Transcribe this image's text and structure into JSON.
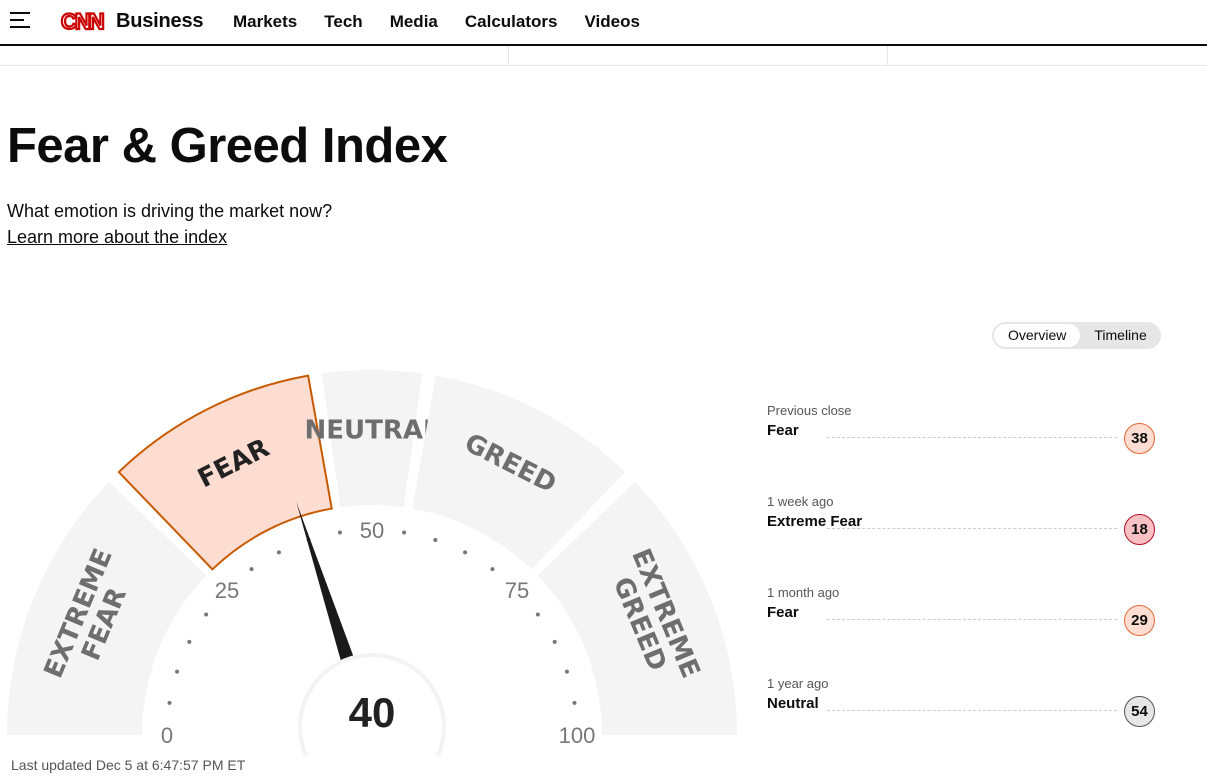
{
  "header": {
    "brand_logo": "CNN",
    "brand_section": "Business",
    "nav": [
      "Markets",
      "Tech",
      "Media",
      "Calculators",
      "Videos"
    ]
  },
  "page": {
    "title": "Fear & Greed Index",
    "subtitle": "What emotion is driving the market now?",
    "learn_link": "Learn more about the index",
    "last_updated": "Last updated Dec 5 at 6:47:57 PM ET"
  },
  "toggle": {
    "options": [
      "Overview",
      "Timeline"
    ],
    "selected": "Overview"
  },
  "gauge": {
    "value": 40,
    "value_label": "40",
    "active_segment": "FEAR",
    "segments": [
      {
        "label": "EXTREME FEAR",
        "lines": [
          "EXTREME",
          "FEAR"
        ],
        "from": 0,
        "to": 25
      },
      {
        "label": "FEAR",
        "lines": [
          "FEAR"
        ],
        "from": 25,
        "to": 45
      },
      {
        "label": "NEUTRAL",
        "lines": [
          "NEUTRAL"
        ],
        "from": 45,
        "to": 55
      },
      {
        "label": "GREED",
        "lines": [
          "GREED"
        ],
        "from": 55,
        "to": 75
      },
      {
        "label": "EXTREME GREED",
        "lines": [
          "EXTREME",
          "GREED"
        ],
        "from": 75,
        "to": 100
      }
    ],
    "tick_labels": [
      "0",
      "25",
      "50",
      "75",
      "100"
    ],
    "colors": {
      "segment": "#f4f4f4",
      "active_fill": "#fddcd1",
      "active_stroke": "#c85a00",
      "needle": "#1a1a1a",
      "text": "#6e6e6e"
    }
  },
  "history": [
    {
      "when": "Previous close",
      "label": "Fear",
      "value": "38",
      "bg": "#fddcd1",
      "border": "#e06a36"
    },
    {
      "when": "1 week ago",
      "label": "Extreme Fear",
      "value": "18",
      "bg": "#f9c0c3",
      "border": "#b0102a"
    },
    {
      "when": "1 month ago",
      "label": "Fear",
      "value": "29",
      "bg": "#fddcd1",
      "border": "#e06a36"
    },
    {
      "when": "1 year ago",
      "label": "Neutral",
      "value": "54",
      "bg": "#e6e6e6",
      "border": "#555555"
    }
  ]
}
